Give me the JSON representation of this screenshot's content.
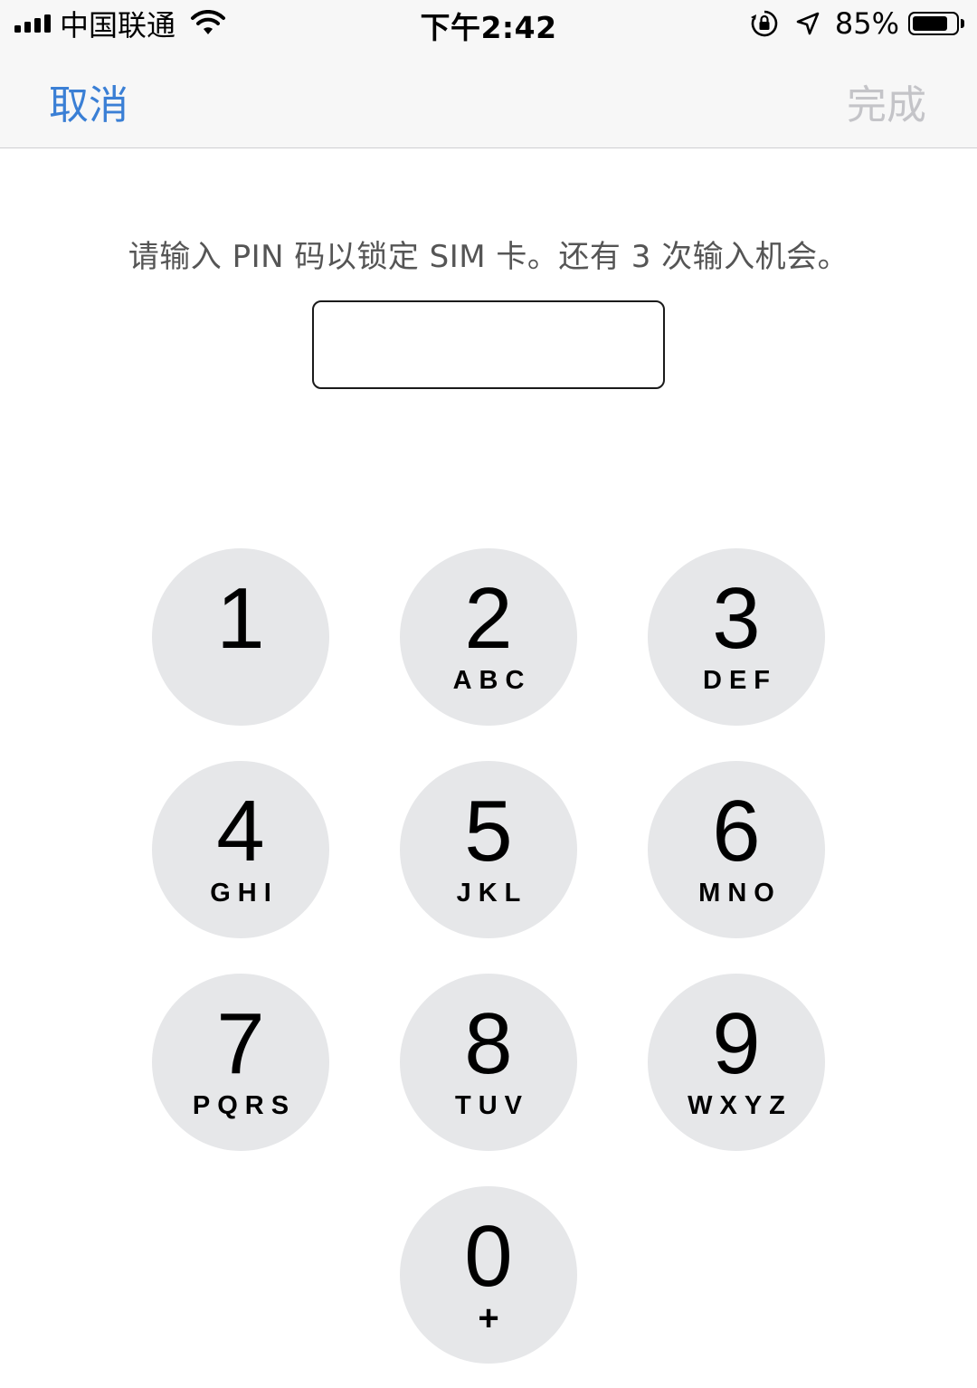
{
  "status_bar": {
    "carrier": "中国联通",
    "time": "下午2:42",
    "battery_percent": "85%",
    "battery_level": 0.85,
    "icons": [
      "signal-icon",
      "wifi-icon",
      "rotation-lock-icon",
      "location-icon",
      "battery-icon"
    ]
  },
  "nav": {
    "cancel_label": "取消",
    "done_label": "完成",
    "cancel_color": "#3a7fd5",
    "done_color": "#c4c4c8"
  },
  "prompt": "请输入 PIN 码以锁定 SIM 卡。还有 3 次输入机会。",
  "pin_field": {
    "value": ""
  },
  "keypad": {
    "keys": [
      {
        "digit": "1",
        "letters": ""
      },
      {
        "digit": "2",
        "letters": "ABC"
      },
      {
        "digit": "3",
        "letters": "DEF"
      },
      {
        "digit": "4",
        "letters": "GHI"
      },
      {
        "digit": "5",
        "letters": "JKL"
      },
      {
        "digit": "6",
        "letters": "MNO"
      },
      {
        "digit": "7",
        "letters": "PQRS"
      },
      {
        "digit": "8",
        "letters": "TUV"
      },
      {
        "digit": "9",
        "letters": "WXYZ"
      },
      {
        "digit": "0",
        "letters": "+"
      }
    ],
    "key_color": "#e6e7e9"
  }
}
